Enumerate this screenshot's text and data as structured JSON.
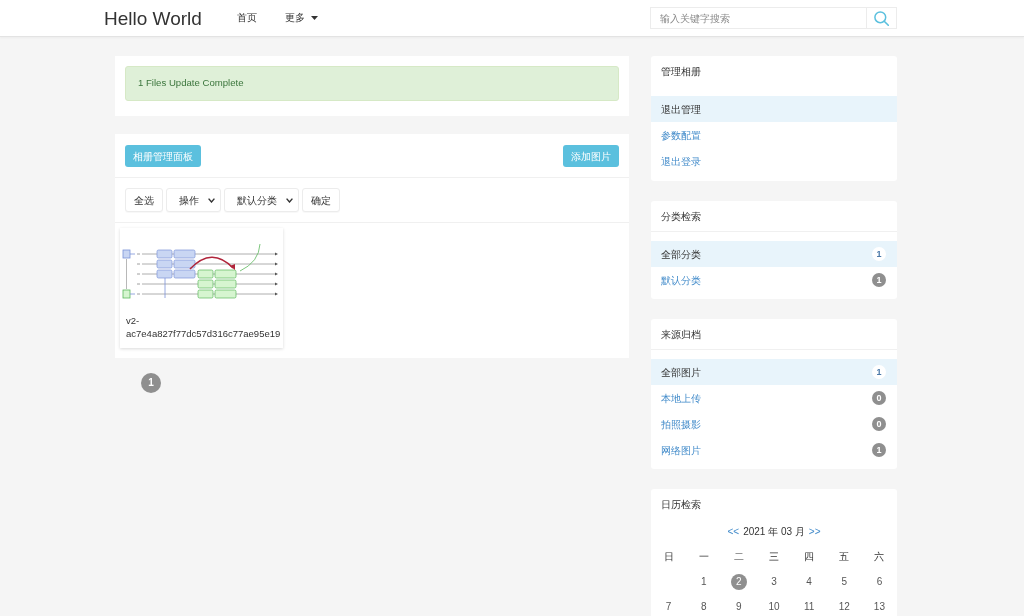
{
  "navbar": {
    "brand": "Hello World",
    "links": [
      {
        "label": "首页",
        "kind": "link"
      },
      {
        "label": "更多",
        "kind": "dropdown"
      }
    ],
    "search": {
      "placeholder": "输入关键字搜索"
    }
  },
  "alert": {
    "text": "1 Files Update Complete"
  },
  "album": {
    "title_button": "相册管理面板",
    "add_button": "添加图片",
    "toolbar": [
      {
        "kind": "button",
        "label": "全选"
      },
      {
        "kind": "select",
        "label": "操作"
      },
      {
        "kind": "select",
        "label": "默认分类"
      },
      {
        "kind": "button",
        "label": "确定"
      }
    ],
    "photos": [
      {
        "caption": "v2-ac7e4a827f77dc57d316c77ae95e19"
      }
    ]
  },
  "pagination": [
    {
      "label": "1",
      "selected": true
    }
  ],
  "sidebar": [
    {
      "kind": "menu",
      "title": "管理相册",
      "items": [
        {
          "label": "退出管理",
          "selected": true
        },
        {
          "label": "参数配置",
          "selected": false
        },
        {
          "label": "退出登录",
          "selected": false
        }
      ]
    },
    {
      "kind": "filter",
      "title": "分类检索",
      "items": [
        {
          "label": "全部分类",
          "count": "1",
          "selected": true
        },
        {
          "label": "默认分类",
          "count": "1",
          "selected": false
        }
      ]
    },
    {
      "kind": "filter",
      "title": "来源归档",
      "items": [
        {
          "label": "全部图片",
          "count": "1",
          "selected": true
        },
        {
          "label": "本地上传",
          "count": "0",
          "selected": false
        },
        {
          "label": "拍照摄影",
          "count": "0",
          "selected": false
        },
        {
          "label": "网络图片",
          "count": "1",
          "selected": false
        }
      ]
    }
  ],
  "calendar": {
    "title": "日历检索",
    "prev": "<<",
    "month": "2021 年 03 月",
    "next": ">>",
    "weekdays": [
      "日",
      "一",
      "二",
      "三",
      "四",
      "五",
      "六"
    ],
    "weeks": [
      [
        {
          "label": "1",
          "selected": false
        },
        {
          "label": "2",
          "selected": true
        },
        {
          "label": "3",
          "selected": false
        },
        {
          "label": "4",
          "selected": false
        },
        {
          "label": "5",
          "selected": false
        },
        {
          "label": "6",
          "selected": false
        }
      ],
      [
        {
          "label": "7",
          "selected": false
        },
        {
          "label": "8",
          "selected": false
        },
        {
          "label": "9",
          "selected": false
        },
        {
          "label": "10",
          "selected": false
        },
        {
          "label": "11",
          "selected": false
        },
        {
          "label": "12",
          "selected": false
        },
        {
          "label": "13",
          "selected": false
        }
      ]
    ]
  }
}
